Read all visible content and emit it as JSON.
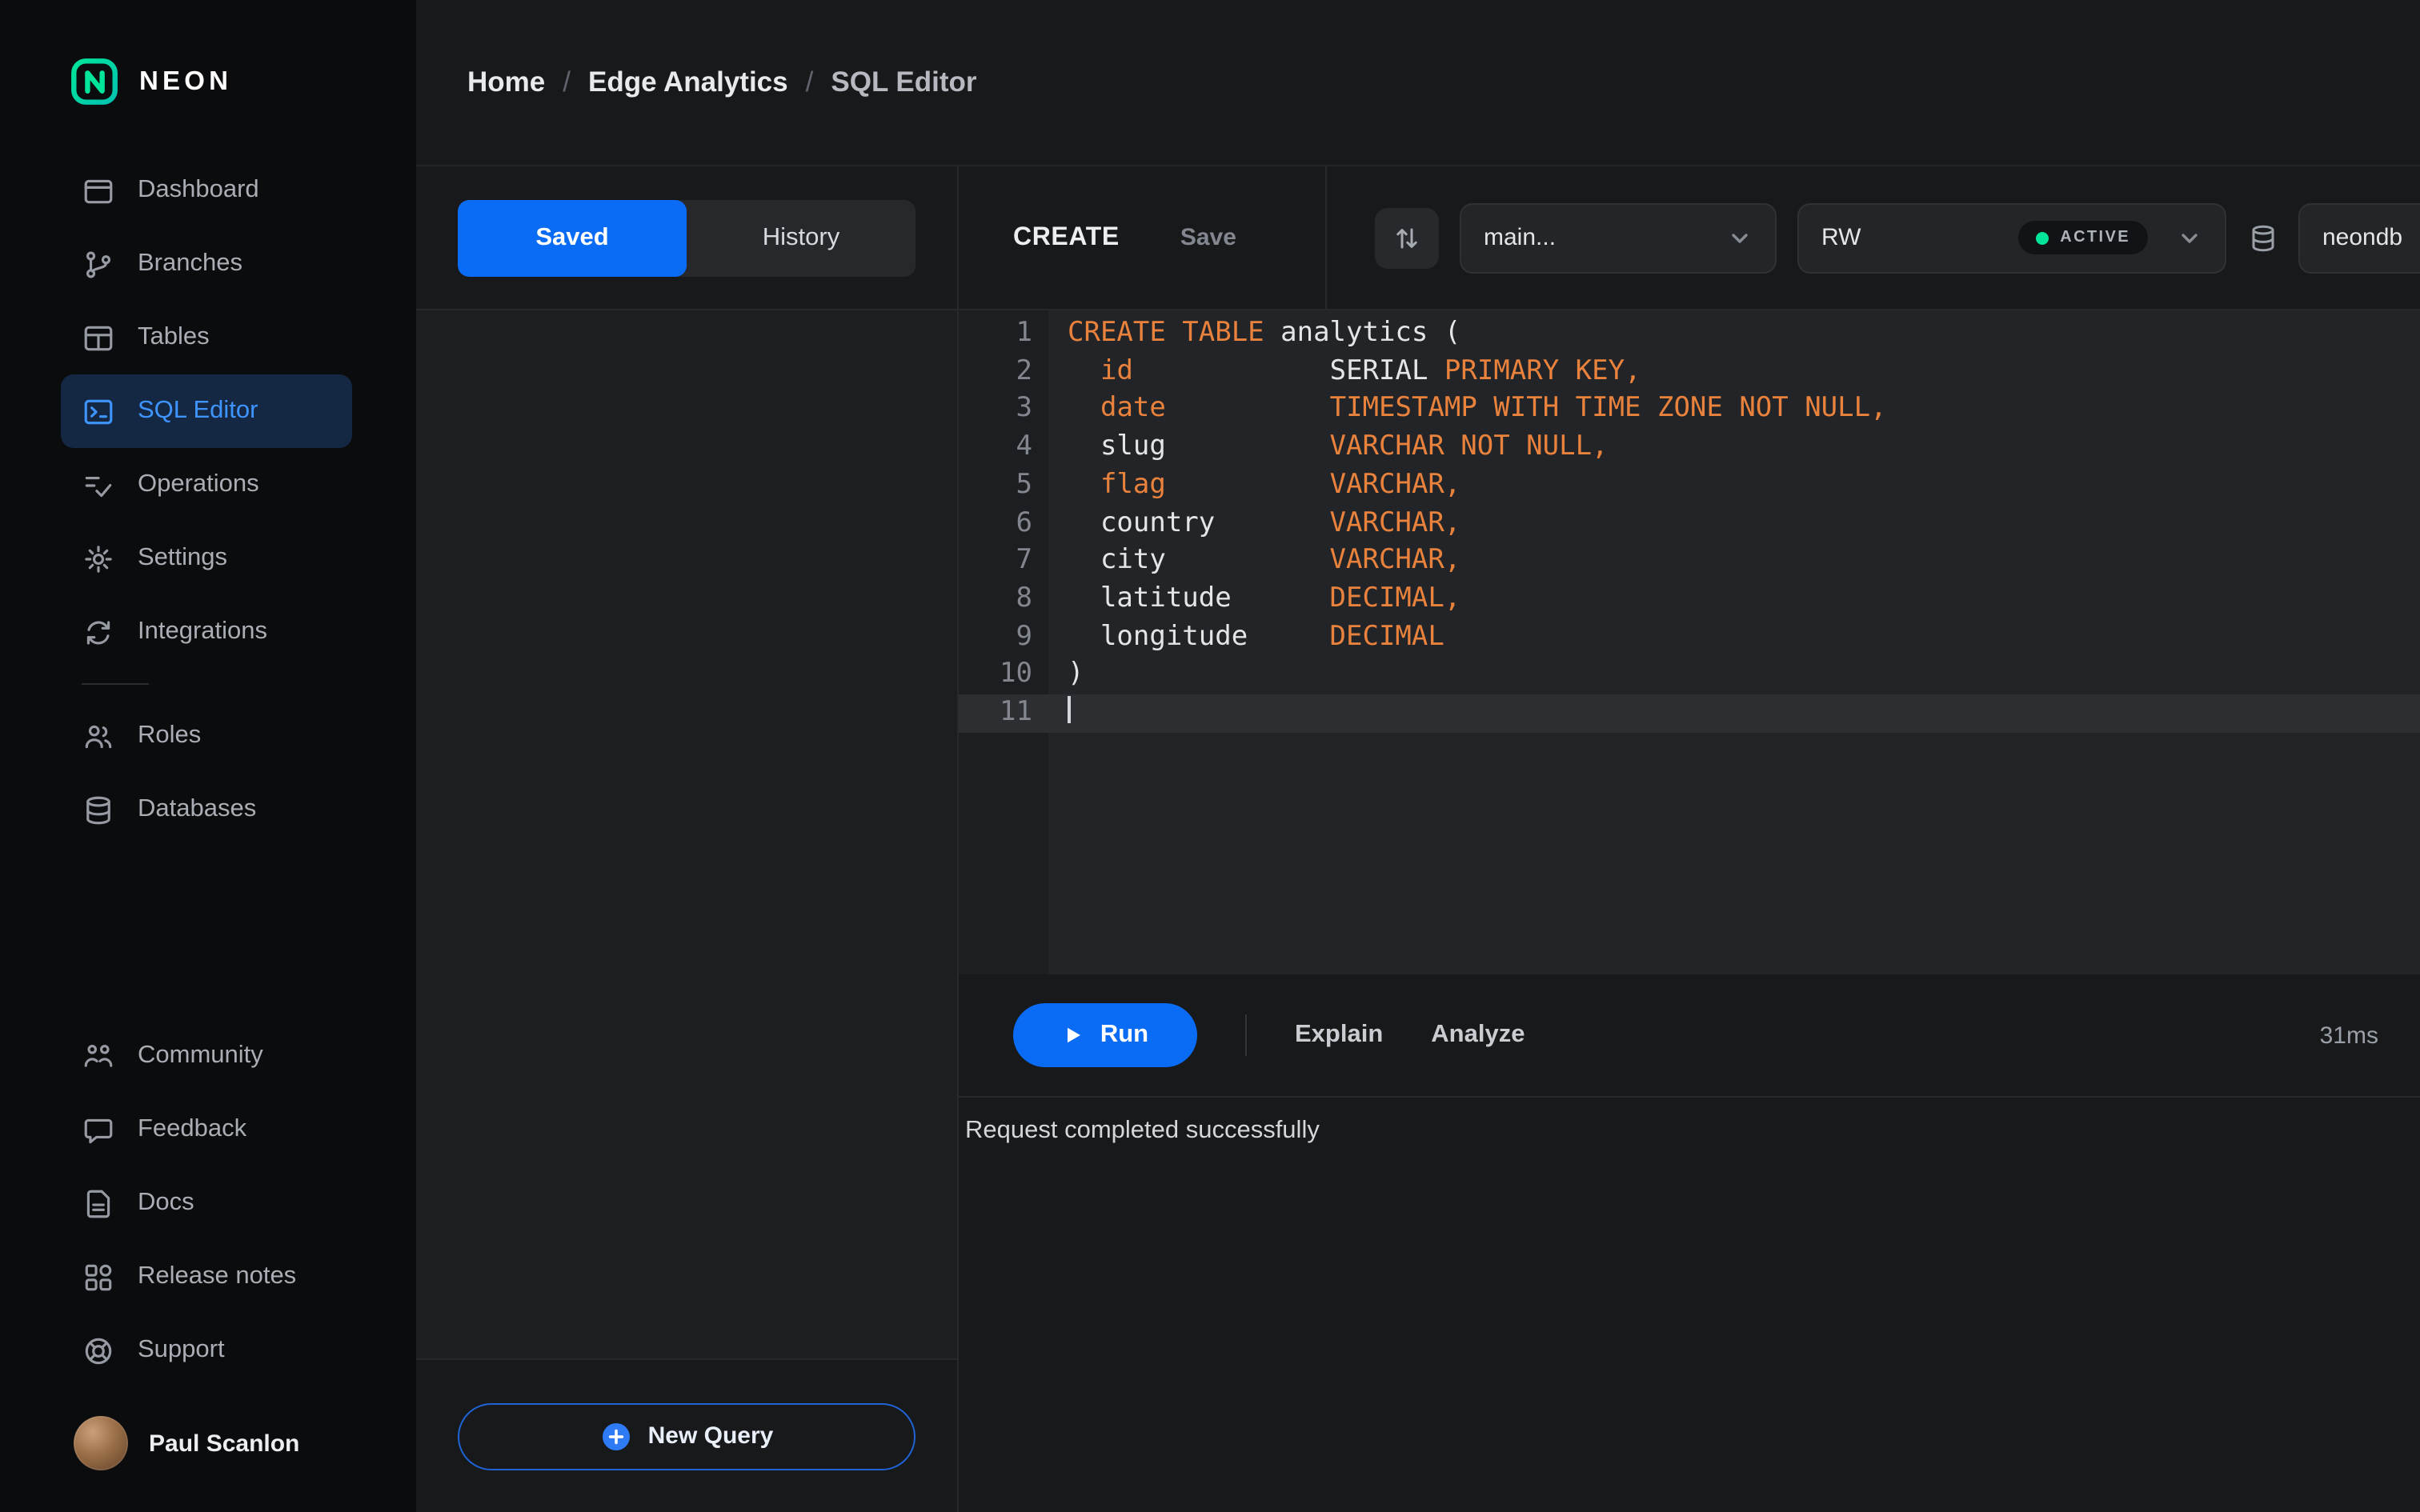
{
  "brand": {
    "name": "NEON"
  },
  "colors": {
    "accent": "#0a6cf5",
    "green": "#00e599",
    "orange": "#e8823c"
  },
  "sidebar": {
    "primary": [
      {
        "label": "Dashboard",
        "active": false
      },
      {
        "label": "Branches",
        "active": false
      },
      {
        "label": "Tables",
        "active": false
      },
      {
        "label": "SQL Editor",
        "active": true
      },
      {
        "label": "Operations",
        "active": false
      },
      {
        "label": "Settings",
        "active": false
      },
      {
        "label": "Integrations",
        "active": false
      }
    ],
    "secondary": [
      {
        "label": "Roles",
        "active": false
      },
      {
        "label": "Databases",
        "active": false
      }
    ],
    "tertiary": [
      {
        "label": "Community",
        "active": false
      },
      {
        "label": "Feedback",
        "active": false
      },
      {
        "label": "Docs",
        "active": false
      },
      {
        "label": "Release notes",
        "active": false
      },
      {
        "label": "Support",
        "active": false
      }
    ],
    "user": {
      "name": "Paul Scanlon"
    }
  },
  "breadcrumb": {
    "segments": [
      "Home",
      "Edge Analytics",
      "SQL Editor"
    ],
    "separator": "/"
  },
  "queries_panel": {
    "tabs": [
      {
        "label": "Saved",
        "active": true
      },
      {
        "label": "History",
        "active": false
      }
    ],
    "new_query_label": "New Query"
  },
  "editor": {
    "query_name": "CREATE",
    "save_label": "Save",
    "branch_select": {
      "value": "main..."
    },
    "endpoint_select": {
      "value": "RW",
      "status": "ACTIVE"
    },
    "database_select": {
      "value": "neondb"
    },
    "code": {
      "active_line": 11,
      "lines": [
        [
          {
            "t": "CREATE TABLE",
            "c": "k"
          },
          {
            "t": " analytics (",
            "c": "p"
          }
        ],
        [
          {
            "t": "  ",
            "c": "p"
          },
          {
            "t": "id",
            "c": "k"
          },
          {
            "t": "            ",
            "c": "p"
          },
          {
            "t": "SERIAL ",
            "c": "p"
          },
          {
            "t": "PRIMARY KEY,",
            "c": "k"
          }
        ],
        [
          {
            "t": "  ",
            "c": "p"
          },
          {
            "t": "date",
            "c": "k"
          },
          {
            "t": "          ",
            "c": "p"
          },
          {
            "t": "TIMESTAMP WITH TIME ZONE NOT NULL,",
            "c": "k"
          }
        ],
        [
          {
            "t": "  slug          ",
            "c": "p"
          },
          {
            "t": "VARCHAR NOT NULL,",
            "c": "k"
          }
        ],
        [
          {
            "t": "  ",
            "c": "p"
          },
          {
            "t": "flag",
            "c": "k"
          },
          {
            "t": "          ",
            "c": "p"
          },
          {
            "t": "VARCHAR,",
            "c": "k"
          }
        ],
        [
          {
            "t": "  country       ",
            "c": "p"
          },
          {
            "t": "VARCHAR,",
            "c": "k"
          }
        ],
        [
          {
            "t": "  city          ",
            "c": "p"
          },
          {
            "t": "VARCHAR,",
            "c": "k"
          }
        ],
        [
          {
            "t": "  latitude      ",
            "c": "p"
          },
          {
            "t": "DECIMAL,",
            "c": "k"
          }
        ],
        [
          {
            "t": "  longitude     ",
            "c": "p"
          },
          {
            "t": "DECIMAL",
            "c": "k"
          }
        ],
        [
          {
            "t": ")",
            "c": "p"
          }
        ],
        []
      ]
    },
    "run_label": "Run",
    "explain_label": "Explain",
    "analyze_label": "Analyze",
    "duration": "31ms",
    "status_message": "Request completed successfully"
  }
}
